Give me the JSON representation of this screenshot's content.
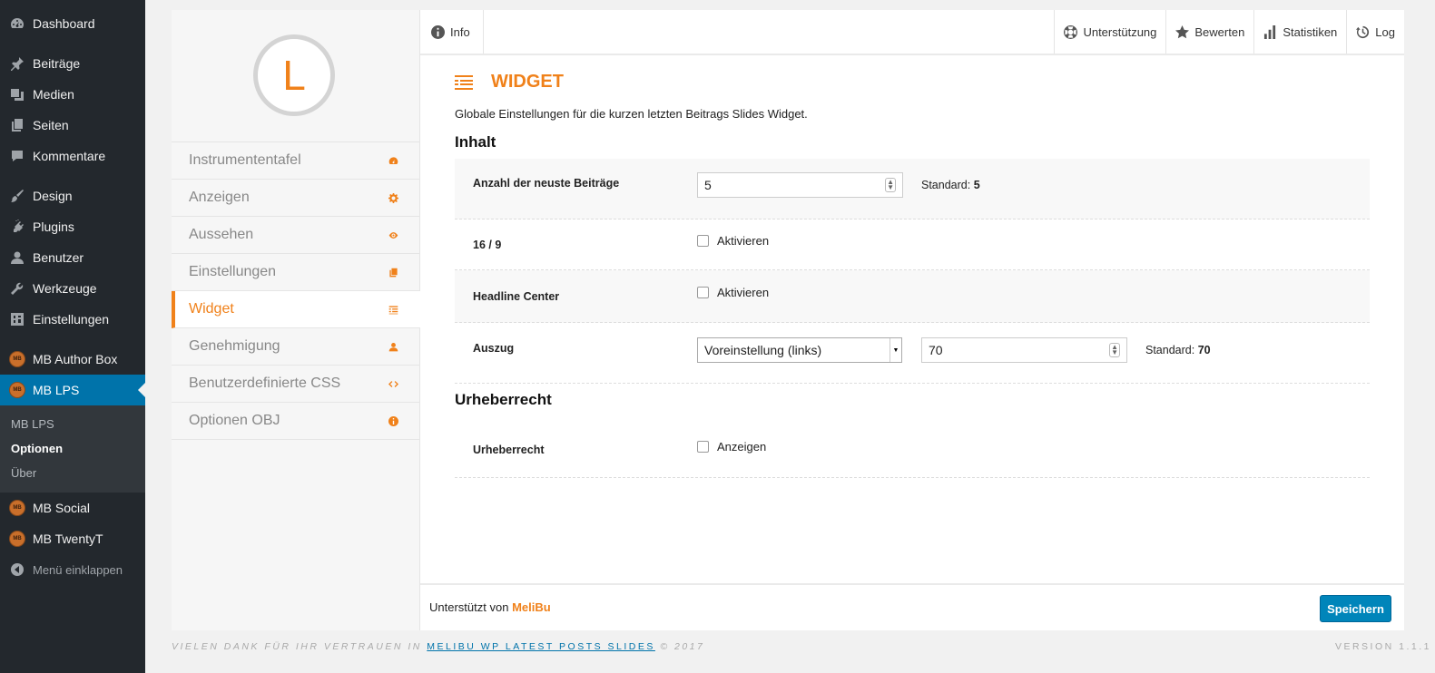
{
  "wp_menu": {
    "dashboard": "Dashboard",
    "posts": "Beiträge",
    "media": "Medien",
    "pages": "Seiten",
    "comments": "Kommentare",
    "design": "Design",
    "plugins": "Plugins",
    "users": "Benutzer",
    "tools": "Werkzeuge",
    "settings": "Einstellungen",
    "mb_author_box": "MB Author Box",
    "mb_lps": "MB LPS",
    "sub_mb_lps": "MB LPS",
    "sub_options": "Optionen",
    "sub_about": "Über",
    "mb_social": "MB Social",
    "mb_twentyt": "MB TwentyT",
    "collapse": "Menü einklappen"
  },
  "plugin": {
    "logo_letter": "L",
    "nav": [
      {
        "label": "Instrumententafel",
        "icon": "dashboard-icon"
      },
      {
        "label": "Anzeigen",
        "icon": "gear-icon"
      },
      {
        "label": "Aussehen",
        "icon": "eye-icon"
      },
      {
        "label": "Einstellungen",
        "icon": "copy-icon"
      },
      {
        "label": "Widget",
        "icon": "list-icon",
        "active": true
      },
      {
        "label": "Genehmigung",
        "icon": "user-icon"
      },
      {
        "label": "Benutzerdefinierte CSS",
        "icon": "code-icon"
      },
      {
        "label": "Optionen OBJ",
        "icon": "info-icon"
      }
    ]
  },
  "topbar": {
    "info": "Info",
    "support": "Unterstützung",
    "rate": "Bewerten",
    "stats": "Statistiken",
    "log": "Log"
  },
  "content": {
    "title": "WIDGET",
    "description": "Globale Einstellungen für die kurzen letzten Beitrags Slides Widget.",
    "group_content": "Inhalt",
    "count_label": "Anzahl der neuste Beiträge",
    "count_value": "5",
    "count_default_label": "Standard:",
    "count_default_value": "5",
    "ratio_label": "16 / 9",
    "ratio_check": "Aktivieren",
    "headline_label": "Headline Center",
    "headline_check": "Aktivieren",
    "excerpt_label": "Auszug",
    "excerpt_select": "Voreinstellung (links)",
    "excerpt_value": "70",
    "excerpt_default_label": "Standard:",
    "excerpt_default_value": "70",
    "group_copyright": "Urheberrecht",
    "copyright_label": "Urheberrecht",
    "copyright_check": "Anzeigen"
  },
  "footer": {
    "powered_prefix": "Unterstützt von",
    "powered_brand": "MeliBu",
    "save": "Speichern"
  },
  "bottom": {
    "thanks_prefix": "VIELEN DANK FÜR IHR VERTRAUEN IN",
    "thanks_link": "MELIBU WP LATEST POSTS SLIDES",
    "thanks_suffix": "© 2017",
    "version": "VERSION 1.1.1"
  },
  "colors": {
    "accent": "#f0811a",
    "wp_sidebar": "#23282d",
    "wp_blue": "#0073aa"
  }
}
